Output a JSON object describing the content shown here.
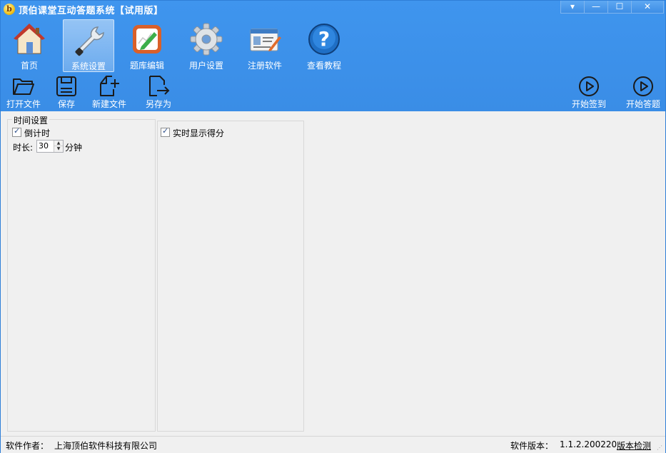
{
  "window": {
    "title": "顶伯课堂互动答题系统【试用版】",
    "logo_letter": "b",
    "controls": [
      "▾",
      "—",
      "☐",
      "✕"
    ]
  },
  "nav": {
    "items": [
      {
        "label": "首页",
        "icon": "home-icon"
      },
      {
        "label": "系统设置",
        "icon": "wrench-icon",
        "active": true
      },
      {
        "label": "题库编辑",
        "icon": "edit-board-icon"
      },
      {
        "label": "用户设置",
        "icon": "gear-icon"
      },
      {
        "label": "注册软件",
        "icon": "register-card-icon"
      },
      {
        "label": "查看教程",
        "icon": "help-icon"
      }
    ]
  },
  "toolbar": {
    "open": "打开文件",
    "save": "保存",
    "new": "新建文件",
    "save_as": "另存为",
    "start_signin": "开始签到",
    "start_answer": "开始答题"
  },
  "settings": {
    "time_group_title": "时间设置",
    "countdown_label": "倒计时",
    "countdown_checked": true,
    "duration_label": "时长:",
    "duration_value": "30",
    "duration_unit": "分钟",
    "realtime_score_label": "实时显示得分",
    "realtime_score_checked": true
  },
  "status": {
    "author_label": "软件作者：",
    "author_value": "上海顶伯软件科技有限公司",
    "version_label": "软件版本：",
    "version_value": "1.1.2.200220",
    "version_check": "版本检测"
  },
  "colors": {
    "accent_blue": "#3b8fe8",
    "content_bg": "#f0f0f0"
  }
}
